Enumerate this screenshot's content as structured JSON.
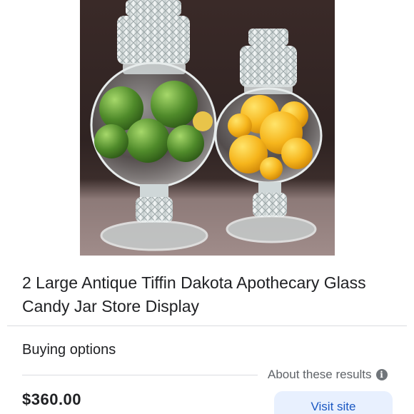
{
  "product": {
    "image_alt": "Two glass apothecary candy jars, one filled with limes and one with lemons",
    "title": "2 Large Antique Tiffin Dakota Apothecary Glass Candy Jar Store Display"
  },
  "buying": {
    "heading": "Buying options",
    "about_label": "About these results",
    "info_icon": "i",
    "price": "$360.00",
    "visit_label": "Visit site"
  },
  "colors": {
    "accent": "#1a57c2",
    "button_bg": "#e8f0fe",
    "text": "#202124",
    "muted": "#5f6368"
  }
}
